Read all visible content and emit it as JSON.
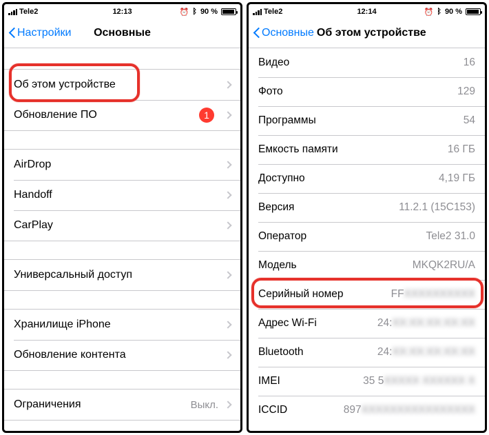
{
  "status": {
    "carrier": "Tele2",
    "time_left": "12:13",
    "time_right": "12:14",
    "battery": "90 %",
    "bt_glyph": "؅",
    "alarm_glyph": "⏰"
  },
  "left": {
    "back": "Настройки",
    "title": "Основные",
    "group1": [
      {
        "label": "Об этом устройстве"
      },
      {
        "label": "Обновление ПО",
        "badge": "1"
      }
    ],
    "group2": [
      {
        "label": "AirDrop"
      },
      {
        "label": "Handoff"
      },
      {
        "label": "CarPlay"
      }
    ],
    "group3": [
      {
        "label": "Универсальный доступ"
      }
    ],
    "group4": [
      {
        "label": "Хранилище iPhone"
      },
      {
        "label": "Обновление контента"
      }
    ],
    "group5": [
      {
        "label": "Ограничения",
        "value": "Выкл."
      }
    ]
  },
  "right": {
    "back": "Основные",
    "title": "Об этом устройстве",
    "rows": [
      {
        "label": "Видео",
        "value": "16"
      },
      {
        "label": "Фото",
        "value": "129"
      },
      {
        "label": "Программы",
        "value": "54"
      },
      {
        "label": "Емкость памяти",
        "value": "16 ГБ"
      },
      {
        "label": "Доступно",
        "value": "4,19 ГБ"
      },
      {
        "label": "Версия",
        "value": "11.2.1 (15C153)"
      },
      {
        "label": "Оператор",
        "value": "Tele2 31.0"
      },
      {
        "label": "Модель",
        "value": "MKQK2RU/A"
      },
      {
        "label": "Серийный номер",
        "value": "FF",
        "blur_tail": "XXXXXXXXXX"
      },
      {
        "label": "Адрес Wi-Fi",
        "value": "24:",
        "blur_tail": "XX:XX:XX:XX:XX"
      },
      {
        "label": "Bluetooth",
        "value": "24:",
        "blur_tail": "XX:XX:XX:XX:XX"
      },
      {
        "label": "IMEI",
        "value": "35 5",
        "blur_tail": "XXXXX XXXXXX X"
      },
      {
        "label": "ICCID",
        "value": "897",
        "blur_tail": "XXXXXXXXXXXXXXXX"
      }
    ]
  }
}
